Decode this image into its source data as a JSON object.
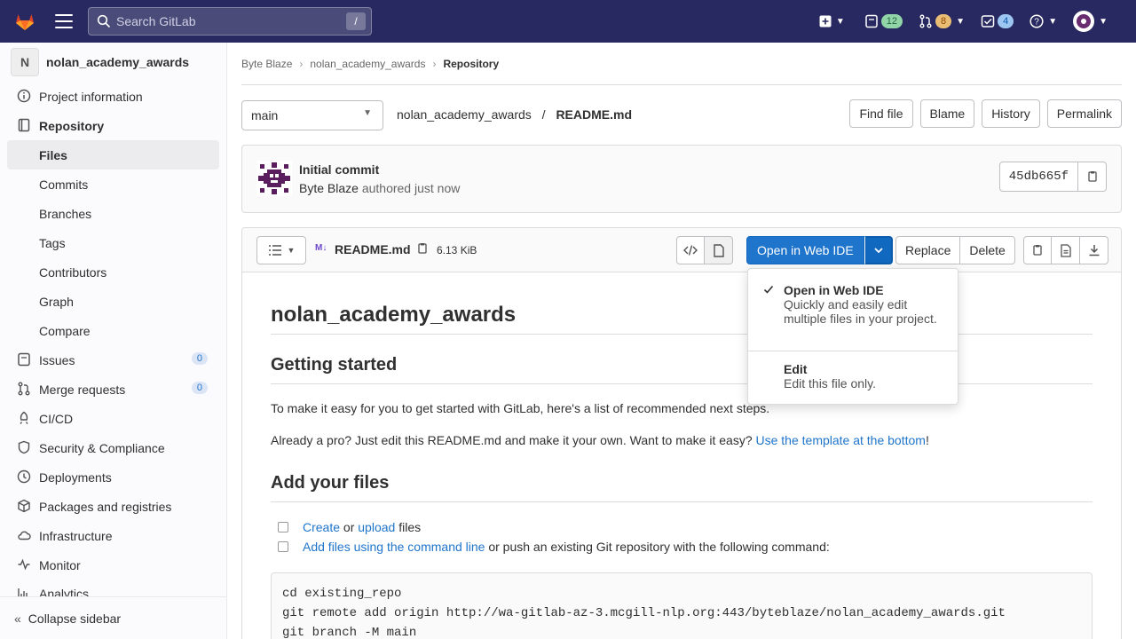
{
  "topbar": {
    "search_placeholder": "Search GitLab",
    "search_shortcut": "/",
    "mr_count": "12",
    "review_count": "8",
    "todo_count": "4",
    "colors": {
      "bg": "#292961",
      "green_pill": "#91d4a8",
      "orange_pill": "#e9be74",
      "blue_pill": "#9dc7f1"
    }
  },
  "sidebar": {
    "project_initial": "N",
    "project_name": "nolan_academy_awards",
    "items": [
      {
        "label": "Project information",
        "icon": "info-icon"
      },
      {
        "label": "Repository",
        "icon": "book-icon"
      },
      {
        "label": "Files"
      },
      {
        "label": "Commits"
      },
      {
        "label": "Branches"
      },
      {
        "label": "Tags"
      },
      {
        "label": "Contributors"
      },
      {
        "label": "Graph"
      },
      {
        "label": "Compare"
      },
      {
        "label": "Issues",
        "icon": "issues-icon",
        "count": "0"
      },
      {
        "label": "Merge requests",
        "icon": "merge-request-icon",
        "count": "0"
      },
      {
        "label": "CI/CD",
        "icon": "rocket-icon"
      },
      {
        "label": "Security & Compliance",
        "icon": "shield-icon"
      },
      {
        "label": "Deployments",
        "icon": "deployments-icon"
      },
      {
        "label": "Packages and registries",
        "icon": "package-icon"
      },
      {
        "label": "Infrastructure",
        "icon": "cloud-icon"
      },
      {
        "label": "Monitor",
        "icon": "monitor-icon"
      },
      {
        "label": "Analytics",
        "icon": "chart-icon"
      }
    ],
    "collapse_label": "Collapse sidebar"
  },
  "breadcrumbs": [
    "Byte Blaze",
    "nolan_academy_awards",
    "Repository"
  ],
  "repo_header": {
    "branch": "main",
    "path_project": "nolan_academy_awards",
    "path_sep": "/",
    "path_file": "README.md",
    "buttons": [
      "Find file",
      "Blame",
      "History",
      "Permalink"
    ]
  },
  "commit": {
    "title": "Initial commit",
    "author": "Byte Blaze",
    "time_text": "authored just now",
    "sha": "45db665f"
  },
  "file": {
    "md_badge": "M↓",
    "name": "README.md",
    "size": "6.13 KiB",
    "ide_label": "Open in Web IDE",
    "replace_label": "Replace",
    "delete_label": "Delete",
    "accent": "#1f75cb"
  },
  "dropdown": {
    "items": [
      {
        "title": "Open in Web IDE",
        "desc": "Quickly and easily edit multiple files in your project.",
        "checked": true
      },
      {
        "title": "Edit",
        "desc": "Edit this file only.",
        "checked": false
      }
    ]
  },
  "readme": {
    "h1": "nolan_academy_awards",
    "h2_start": "Getting started",
    "p1": "To make it easy for you to get started with GitLab, here's a list of recommended next steps.",
    "p2_pre": "Already a pro? Just edit this README.md and make it your own. Want to make it easy? ",
    "p2_link": "Use the template at the bottom",
    "p2_post": "!",
    "h2_files": "Add your files",
    "task1_link1": "Create",
    "task1_mid": " or ",
    "task1_link2": "upload",
    "task1_post": " files",
    "task2_link": "Add files using the command line",
    "task2_post": " or push an existing Git repository with the following command:",
    "code": [
      "cd existing_repo",
      "git remote add origin http://wa-gitlab-az-3.mcgill-nlp.org:443/byteblaze/nolan_academy_awards.git",
      "git branch -M main"
    ]
  }
}
